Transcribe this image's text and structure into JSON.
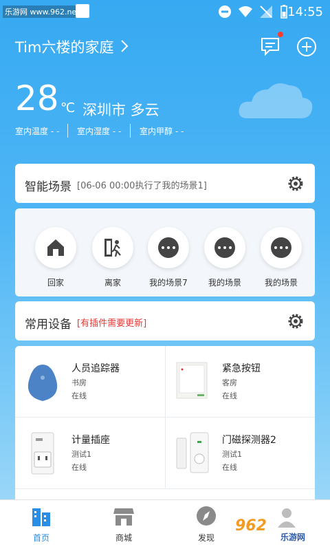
{
  "status_bar": {
    "watermark": "乐游网 www.962.net",
    "time": "14:55"
  },
  "header": {
    "home_name": "Tim六楼的家庭"
  },
  "weather": {
    "temperature": "28",
    "unit": "℃",
    "location_condition": "深圳市 多云",
    "indoor": [
      "室内温度 - -",
      "室内湿度 - -",
      "室内甲醇 - -"
    ]
  },
  "smart_scene": {
    "title": "智能场景",
    "log": "[06-06 00:00执行了我的场景1]",
    "scenes": [
      {
        "label": "回家",
        "icon": "home-icon"
      },
      {
        "label": "离家",
        "icon": "leave-home-icon"
      },
      {
        "label": "我的场景7",
        "icon": "more-dots-icon"
      },
      {
        "label": "我的场景",
        "icon": "more-dots-icon"
      },
      {
        "label": "我的场景",
        "icon": "more-dots-icon"
      }
    ]
  },
  "common_devices": {
    "title": "常用设备",
    "notice": "[有插件需要更新]",
    "devices": [
      {
        "name": "人员追踪器",
        "room": "书房",
        "status": "在线"
      },
      {
        "name": "紧急按钮",
        "room": "客房",
        "status": "在线"
      },
      {
        "name": "计量插座",
        "room": "测试1",
        "status": "在线"
      },
      {
        "name": "门磁探测器2",
        "room": "测试1",
        "status": "在线"
      }
    ]
  },
  "bottom_nav": {
    "items": [
      {
        "label": "首页",
        "icon": "home-buildings-icon",
        "active": true
      },
      {
        "label": "商城",
        "icon": "store-icon",
        "active": false
      },
      {
        "label": "发现",
        "icon": "compass-icon",
        "active": false
      }
    ],
    "watermark_brand": "962",
    "watermark_site": "乐游网"
  },
  "colors": {
    "accent": "#2a8de6",
    "notice": "#e53935",
    "background_top": "#36a9f2"
  }
}
